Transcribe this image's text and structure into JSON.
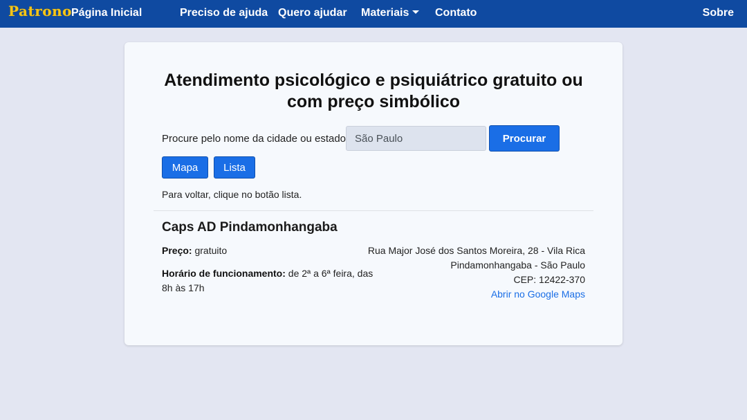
{
  "nav": {
    "brand": "Patrono",
    "home": "Página Inicial",
    "need_help": "Preciso de ajuda",
    "want_help": "Quero ajudar",
    "materials": "Materiais",
    "contact": "Contato",
    "about": "Sobre"
  },
  "main": {
    "title_line1": "Atendimento psicológico e psiquiátrico gratuito ou",
    "title_line2": "com preço simbólico",
    "search_label": "Procure pelo nome da cidade ou estado:",
    "search_value": "São Paulo",
    "search_button": "Procurar",
    "map_button": "Mapa",
    "list_button": "Lista",
    "hint": "Para voltar, clique no botão lista."
  },
  "place": {
    "name": "Caps AD Pindamonhangaba",
    "price_label": "Preço:",
    "price_value": "gratuito",
    "hours_label": "Horário de funcionamento:",
    "hours_value": "de 2ª a 6ª feira, das 8h às 17h",
    "address_line1": "Rua Major José dos Santos Moreira, 28 - Vila Rica",
    "address_line2": "Pindamonhangaba - São Paulo",
    "cep": "CEP: 12422-370",
    "maps_link": "Abrir no Google Maps"
  },
  "colors": {
    "navbar": "#0f4aa1",
    "brand": "#f5c518",
    "primary_button": "#1a6ee6",
    "background": "#e3e6f2",
    "card": "#f6f9fd"
  }
}
